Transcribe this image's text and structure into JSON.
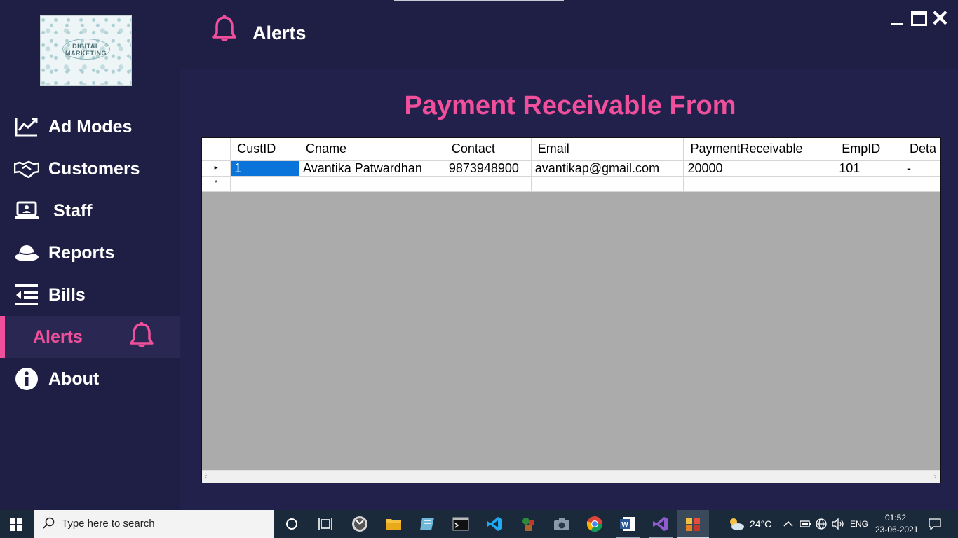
{
  "app": {
    "logo_text_line1": "DIGITAL",
    "logo_text_line2": "MARKETING",
    "logo_icon": "digital-marketing-logo"
  },
  "sidebar": {
    "items": [
      {
        "label": "Ad Modes",
        "icon": "line-chart-icon"
      },
      {
        "label": "Customers",
        "icon": "handshake-icon"
      },
      {
        "label": "Staff",
        "icon": "laptop-user-icon"
      },
      {
        "label": "Reports",
        "icon": "hat-icon"
      },
      {
        "label": "Bills",
        "icon": "list-indent-icon"
      },
      {
        "label": "Alerts",
        "icon": "bell-icon",
        "active": true
      },
      {
        "label": "About",
        "icon": "info-circle-icon"
      }
    ]
  },
  "header": {
    "title": "Alerts",
    "icon": "bell-icon"
  },
  "window_controls": {
    "minimize": "minimize-icon",
    "maximize": "maximize-icon",
    "close": "✕"
  },
  "main": {
    "title": "Payment Receivable From"
  },
  "grid": {
    "columns": [
      "CustID",
      "Cname",
      "Contact",
      "Email",
      "PaymentReceivable",
      "EmpID",
      "Deta"
    ],
    "rows": [
      {
        "row_header": "▸",
        "cells": [
          "1",
          "Avantika Patwardhan",
          "9873948900",
          "avantikap@gmail.com",
          "20000",
          "101",
          "-"
        ]
      }
    ],
    "new_row_marker": "*"
  },
  "taskbar": {
    "search_placeholder": "Type here to search",
    "weather_temp": "24°C",
    "language": "ENG",
    "time": "01:52",
    "date": "23-06-2021"
  },
  "colors": {
    "sidebar_bg": "#1f1e44",
    "content_bg": "#22214c",
    "accent": "#f0509b",
    "selection": "#0a74da",
    "taskbar_bg": "#1b2a3b"
  }
}
